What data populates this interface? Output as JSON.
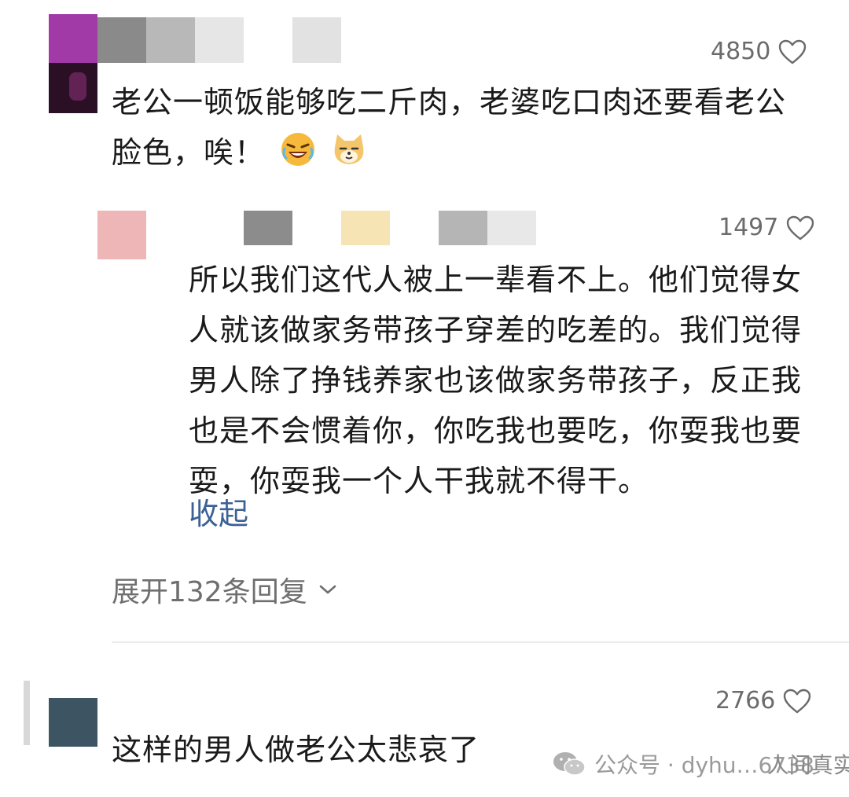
{
  "comments": [
    {
      "likes": "4850",
      "text_line1": "老公一顿饭能够吃二斤肉，老婆吃口肉还要看老公",
      "text_line2": "脸色，唉！",
      "emojis": [
        "laugh-cry-emoji",
        "doge-cat-emoji"
      ],
      "reply": {
        "likes": "1497",
        "lines": [
          "所以我们这代人被上一辈看不上。他们觉得女",
          "人就该做家务带孩子穿差的吃差的。我们觉得",
          "男人除了挣钱养家也该做家务带孩子，反正我",
          "也是不会惯着你，你吃我也要吃，你耍我也要",
          "耍，你耍我一个人干我就不得干。"
        ],
        "collapse_label": "收起"
      },
      "expand_replies_label": "展开132条回复"
    },
    {
      "likes": "2766",
      "text": "这样的男人做老公太悲哀了"
    }
  ],
  "watermark": {
    "left": "公众号 · dyhu…6738",
    "right": "人间真实事"
  },
  "colors": {
    "link": "#3c6194",
    "muted": "#6f6f6f",
    "avatar1": "#9b3a9b",
    "avatar3": "#3d5563"
  }
}
